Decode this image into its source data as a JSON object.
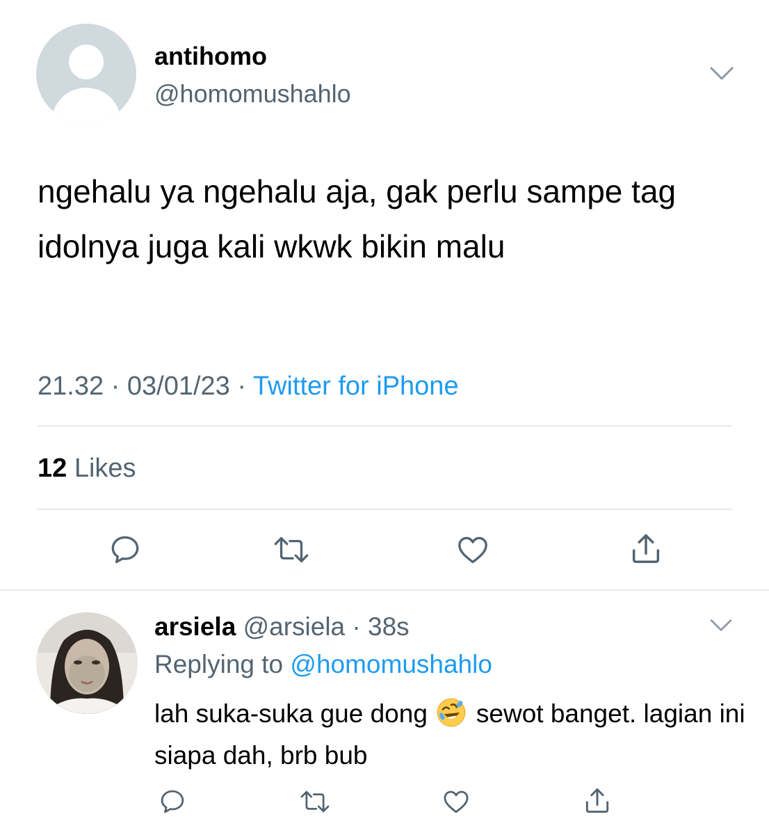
{
  "tweet": {
    "display_name": "antihomo",
    "handle": "@homomushahlo",
    "text": "ngehalu ya ngehalu aja, gak perlu sampe tag idolnya juga kali wkwk bikin malu",
    "time": "21.32",
    "date": "03/01/23",
    "source": "Twitter for iPhone",
    "likes_count": "12",
    "likes_label": "Likes",
    "avatar_icon": "default-profile-icon",
    "menu_icon": "chevron-down-icon"
  },
  "reply": {
    "display_name": "arsiela",
    "handle": "@arsiela",
    "age": "38s",
    "replying_prefix": "Replying to",
    "replying_handle": "@homomushahlo",
    "text_before_emoji": "lah suka-suka gue dong",
    "emoji": "rolling-on-floor-laughing-emoji",
    "text_after_emoji": "sewot banget. lagian ini siapa dah, brb bub",
    "menu_icon": "chevron-down-icon"
  },
  "actions": [
    "reply-icon",
    "retweet-icon",
    "like-icon",
    "share-icon"
  ],
  "colors": {
    "accent": "#1d9bf0",
    "secondary_text": "#536471",
    "divider": "#e7e9ea",
    "icon": "#536471"
  }
}
